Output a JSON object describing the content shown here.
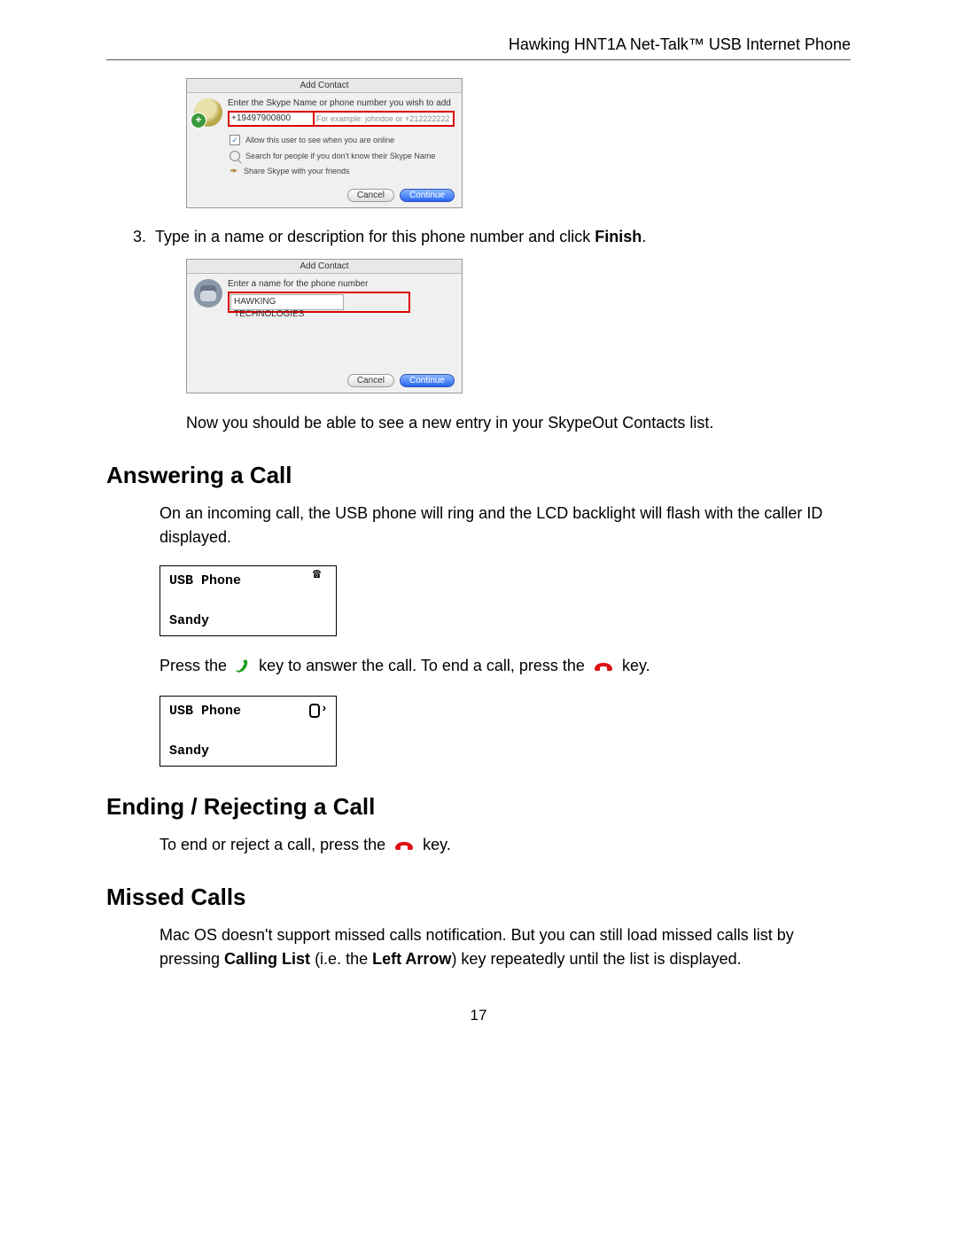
{
  "header": {
    "title": "Hawking HNT1A Net-Talk™ USB Internet Phone"
  },
  "dialog1": {
    "title": "Add Contact",
    "prompt": "Enter the Skype Name or phone number you wish to add",
    "phone_value": "+19497900800",
    "example_hint": "For example: johndoe or +212222222",
    "allow_label": "Allow this user to see when you are online",
    "search_label": "Search for people if you don't know their Skype Name",
    "share_label": "Share Skype with your friends",
    "cancel": "Cancel",
    "continue": "Continue"
  },
  "step3": {
    "num": "3.",
    "text_a": "Type in a name or description for this phone number and click ",
    "text_b": "Finish",
    "text_c": "."
  },
  "dialog2": {
    "title": "Add Contact",
    "prompt": "Enter a name for the phone number",
    "name_value": "HAWKING TECHNOLOGIES",
    "cancel": "Cancel",
    "continue": "Continue"
  },
  "after_dialogs": "Now you should be able to see a new entry in your SkypeOut Contacts list.",
  "sec_answer": {
    "heading": "Answering a Call",
    "p1": "On an incoming call, the USB phone will ring and the LCD backlight will flash with the caller ID displayed.",
    "lcd1_line1": "USB Phone",
    "lcd1_line2": "Sandy",
    "press_a": "Press the ",
    "press_b": " key to answer the call. To end a call, press the ",
    "press_c": " key.",
    "lcd2_line1": "USB Phone",
    "lcd2_line2": "Sandy"
  },
  "sec_end": {
    "heading": "Ending / Rejecting a Call",
    "p_a": "To end or reject a call, press the ",
    "p_b": " key."
  },
  "sec_missed": {
    "heading": "Missed Calls",
    "p_a": "Mac OS doesn't support missed calls notification. But you can still load missed calls list by pressing ",
    "p_b": "Calling List",
    "p_c": " (i.e. the ",
    "p_d": "Left Arrow",
    "p_e": ") key repeatedly until the list is displayed."
  },
  "footer": {
    "page": "17"
  }
}
